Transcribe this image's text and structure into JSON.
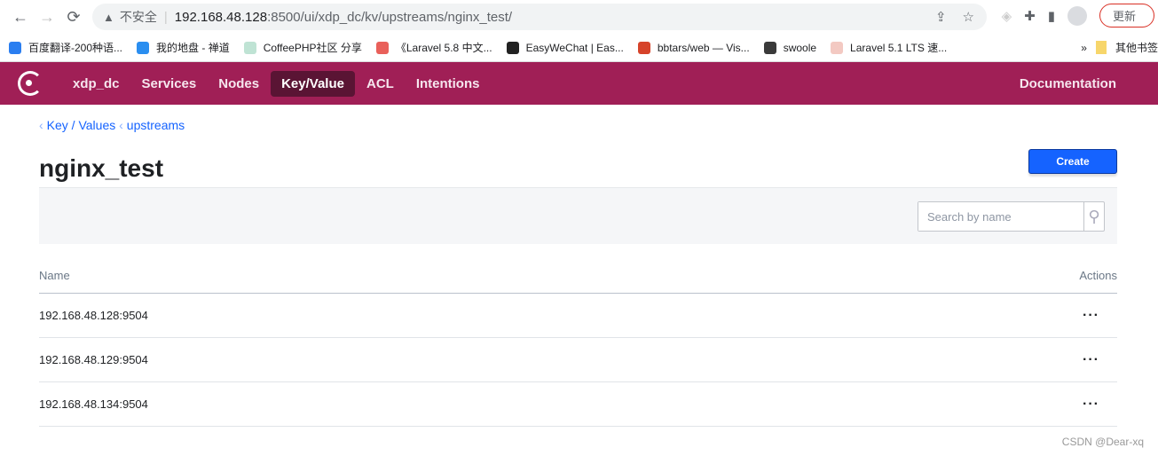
{
  "browser": {
    "back": "←",
    "forward": "→",
    "reload": "⟳",
    "insecure": "不安全",
    "url_host": "192.168.48.128",
    "url_path": ":8500/ui/xdp_dc/kv/upstreams/nginx_test/",
    "update": "更新",
    "bookmarks": [
      {
        "label": "百度翻译-200种语...",
        "color": "#2a7ef0"
      },
      {
        "label": "我的地盘 - 禅道",
        "color": "#2a8ef0"
      },
      {
        "label": "CoffeePHP社区 分享",
        "color": "#bfe3d4"
      },
      {
        "label": "《Laravel 5.8 中文...",
        "color": "#e9605a"
      },
      {
        "label": "EasyWeChat | Eas...",
        "color": "#222222"
      },
      {
        "label": "bbtars/web — Vis...",
        "color": "#d6432a"
      },
      {
        "label": "swoole",
        "color": "#3a3a3a"
      },
      {
        "label": "Laravel 5.1 LTS 速...",
        "color": "#f3c9c2"
      }
    ],
    "more": "»",
    "other_bookmarks": "其他书签"
  },
  "nav": {
    "dc": "xdp_dc",
    "items": [
      "Services",
      "Nodes",
      "Key/Value",
      "ACL",
      "Intentions"
    ],
    "active": "Key/Value",
    "documentation": "Documentation"
  },
  "breadcrumb": [
    "Key / Values",
    "upstreams"
  ],
  "title": "nginx_test",
  "create": "Create",
  "search": {
    "placeholder": "Search by name"
  },
  "table": {
    "headers": [
      "Name",
      "Actions"
    ],
    "rows": [
      "192.168.48.128:9504",
      "192.168.48.129:9504",
      "192.168.48.134:9504"
    ],
    "action": "···"
  },
  "watermark": "CSDN @Dear-xq"
}
